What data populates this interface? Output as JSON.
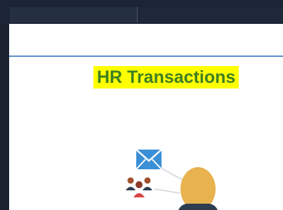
{
  "page": {
    "title": "HR Transactions"
  },
  "colors": {
    "topbar": "#1c2536",
    "header_rule": "#5b8ec9",
    "title_highlight": "#ffff00",
    "title_text": "#3e7f21",
    "person_skin": "#e8b24e",
    "envelope": "#3b8fd6",
    "group_icon_brown": "#a0522d",
    "group_icon_red": "#d64541",
    "group_icon_dark": "#2d3e50"
  },
  "icons": {
    "envelope": "mail-icon",
    "group": "people-group-icon",
    "person": "person-avatar-icon"
  }
}
